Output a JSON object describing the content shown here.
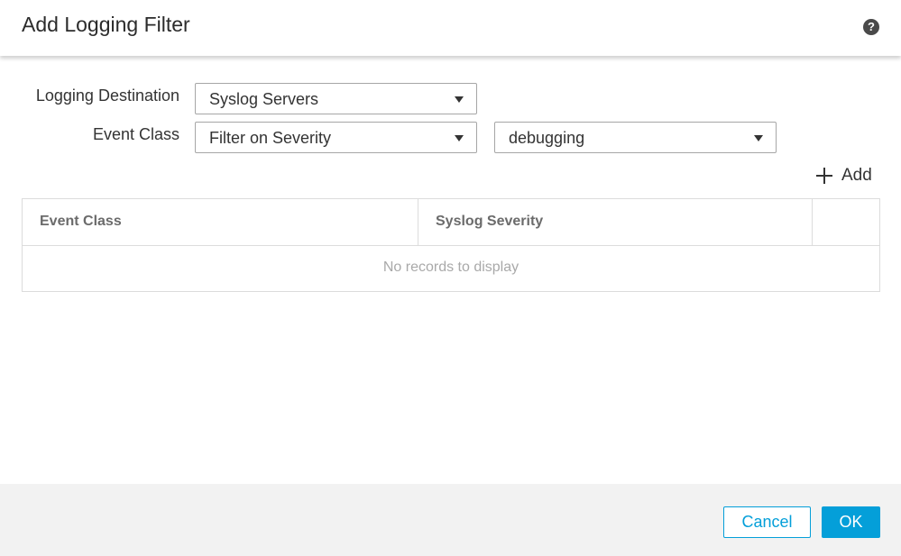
{
  "dialog": {
    "title": "Add Logging Filter",
    "help_icon": "?"
  },
  "form": {
    "logging_destination": {
      "label": "Logging Destination",
      "value": "Syslog Servers"
    },
    "event_class": {
      "label": "Event Class",
      "value": "Filter on Severity",
      "severity_value": "debugging"
    },
    "add_label": "Add"
  },
  "table": {
    "columns": [
      "Event Class",
      "Syslog Severity",
      ""
    ],
    "empty_message": "No records to display"
  },
  "footer": {
    "cancel_label": "Cancel",
    "ok_label": "OK"
  },
  "colors": {
    "accent": "#049fd9",
    "footer_bg": "#f2f2f2"
  },
  "icons": [
    "help-icon",
    "chevron-down-icon",
    "plus-icon"
  ]
}
